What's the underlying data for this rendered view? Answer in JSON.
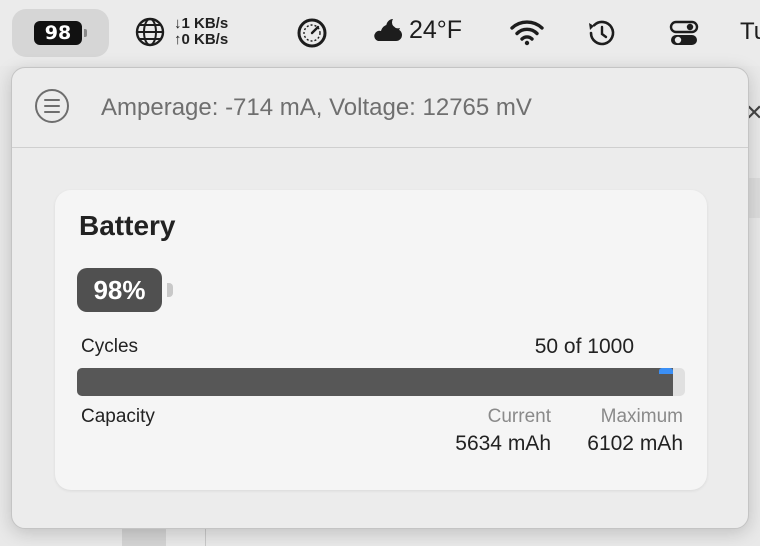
{
  "menubar": {
    "battery_percent": "98",
    "network": {
      "down": "↓1 KB/s",
      "up": "↑0 KB/s"
    },
    "weather": {
      "temp": "24°F"
    },
    "clock_partial": "Tu"
  },
  "popover": {
    "header_status": "Amperage: -714 mA, Voltage: 12765 mV",
    "card": {
      "title": "Battery",
      "level_label": "98%",
      "cycles_label": "Cycles",
      "cycles_value": "50 of 1000",
      "cycles_fraction": 0.98,
      "capacity_label": "Capacity",
      "current_header": "Current",
      "maximum_header": "Maximum",
      "current_value": "5634 mAh",
      "maximum_value": "6102 mAh"
    }
  },
  "colors": {
    "accent": "#3b8ff5",
    "bar_fill": "#575757",
    "battery_badge": "#505050"
  },
  "icons": [
    "battery-icon",
    "globe-icon",
    "gauge-icon",
    "weather-icon",
    "wifi-icon",
    "time-machine-icon",
    "control-center-icon",
    "menu-icon",
    "close-icon"
  ]
}
